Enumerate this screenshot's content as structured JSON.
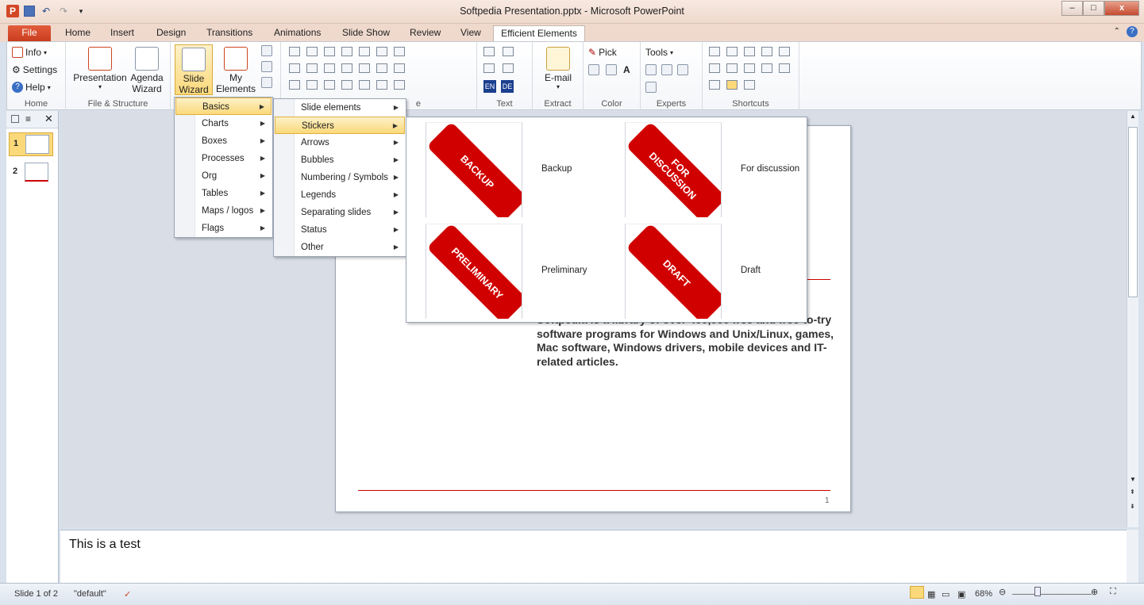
{
  "window": {
    "title": "Softpedia Presentation.pptx - Microsoft PowerPoint",
    "app_icon": "P",
    "controls": {
      "minimize": "–",
      "maximize": "□",
      "close": "x"
    }
  },
  "quick_access": {
    "save_icon": "save-icon",
    "undo_icon": "undo-icon",
    "redo_icon": "redo-icon"
  },
  "tabs": [
    "File",
    "Home",
    "Insert",
    "Design",
    "Transitions",
    "Animations",
    "Slide Show",
    "Review",
    "View",
    "Efficient Elements"
  ],
  "active_tab": "Efficient Elements",
  "ribbon": {
    "home_group": {
      "info": "Info",
      "settings": "Settings",
      "help": "Help",
      "label": "Home"
    },
    "file_structure_group": {
      "presentation": "Presentation",
      "agenda_line1": "Agenda",
      "agenda_line2": "Wizard",
      "label": "File & Structure"
    },
    "slide_wizard_line1": "Slide",
    "slide_wizard_line2": "Wizard",
    "my_elements_line1": "My",
    "my_elements_line2": "Elements",
    "text_group": {
      "en": "EN",
      "de": "DE",
      "label": "Text"
    },
    "extract_group": {
      "email": "E-mail",
      "label": "Extract"
    },
    "color_group": {
      "pick": "Pick",
      "label": "Color"
    },
    "experts_group": {
      "tools": "Tools",
      "label": "Experts"
    },
    "shortcuts_group": {
      "label": "Shortcuts"
    },
    "partial_label": "e"
  },
  "menu_level1": {
    "items": [
      "Basics",
      "Charts",
      "Boxes",
      "Processes",
      "Org",
      "Tables",
      "Maps / logos",
      "Flags"
    ],
    "highlighted": "Basics"
  },
  "menu_level2": {
    "items": [
      "Slide elements",
      "Stickers",
      "Arrows",
      "Bubbles",
      "Numbering / Symbols",
      "Legends",
      "Separating slides",
      "Status",
      "Other"
    ],
    "highlighted": "Stickers"
  },
  "stickers": [
    {
      "sticker": "BACKUP",
      "label": "Backup"
    },
    {
      "sticker": "FOR DISCUSSION",
      "label": "For discussion"
    },
    {
      "sticker": "PRELIMINARY",
      "label": "Preliminary"
    },
    {
      "sticker": "DRAFT",
      "label": "Draft"
    }
  ],
  "slide": {
    "body_text": "Softpedia is a library of over 400,000 free and free-to-try software programs for Windows and Unix/Linux, games, Mac software, Windows drivers, mobile devices and IT-related articles.",
    "page_number": "1"
  },
  "thumbnails": [
    "1",
    "2"
  ],
  "notes": "This is a test",
  "status_bar": {
    "slide": "Slide 1 of 2",
    "theme": "\"default\"",
    "zoom": "68%"
  },
  "colors": {
    "accent": "#d24726",
    "sticker_red": "#d10000",
    "highlight": "#fbd97a"
  }
}
